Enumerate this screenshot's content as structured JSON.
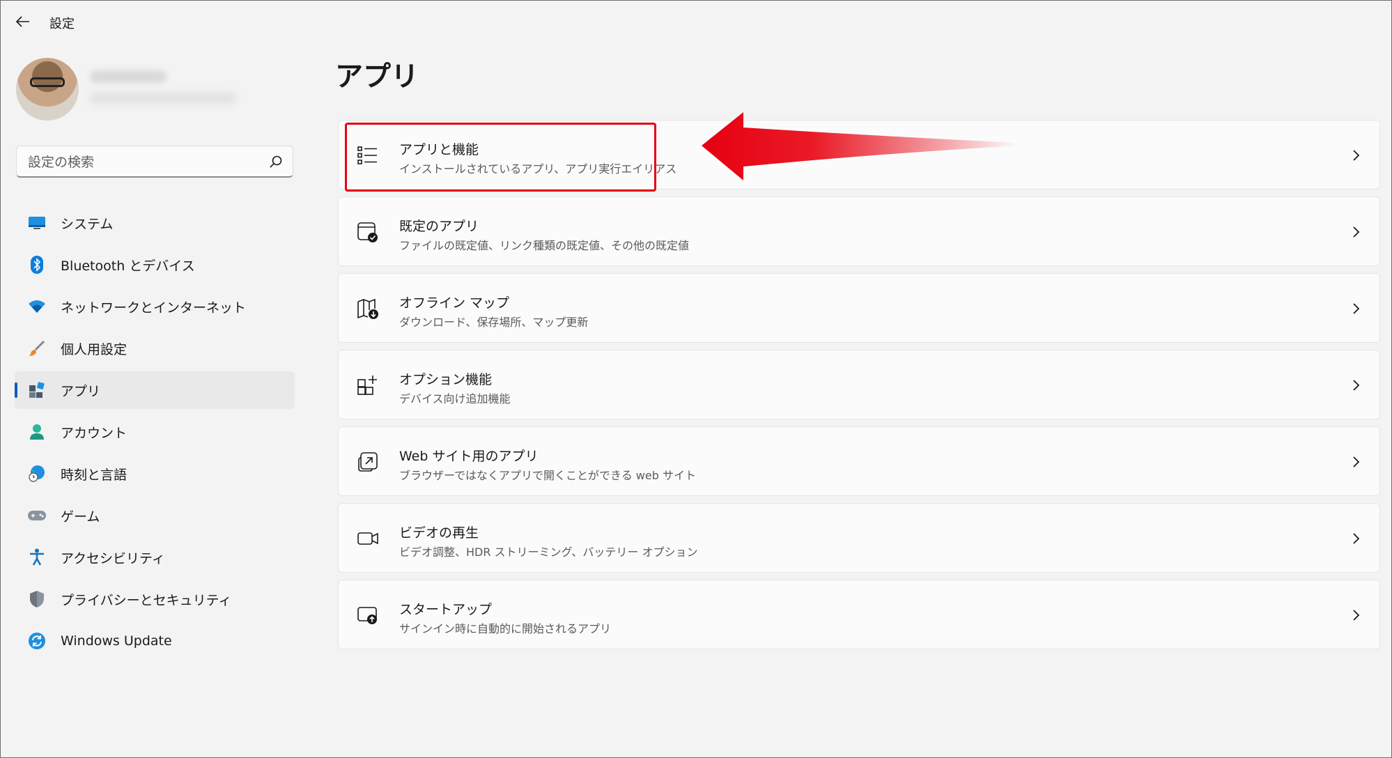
{
  "window": {
    "title": "設定"
  },
  "profile": {
    "name": "",
    "email": ""
  },
  "search": {
    "placeholder": "設定の検索"
  },
  "nav": [
    {
      "label": "システム",
      "icon": "monitor-icon"
    },
    {
      "label": "Bluetooth とデバイス",
      "icon": "bluetooth-icon"
    },
    {
      "label": "ネットワークとインターネット",
      "icon": "wifi-icon"
    },
    {
      "label": "個人用設定",
      "icon": "brush-icon"
    },
    {
      "label": "アプリ",
      "icon": "apps-icon",
      "active": true
    },
    {
      "label": "アカウント",
      "icon": "person-icon"
    },
    {
      "label": "時刻と言語",
      "icon": "globe-clock-icon"
    },
    {
      "label": "ゲーム",
      "icon": "gamepad-icon"
    },
    {
      "label": "アクセシビリティ",
      "icon": "accessibility-icon"
    },
    {
      "label": "プライバシーとセキュリティ",
      "icon": "shield-icon"
    },
    {
      "label": "Windows Update",
      "icon": "sync-icon"
    }
  ],
  "main": {
    "title": "アプリ",
    "cards": [
      {
        "title": "アプリと機能",
        "subtitle": "インストールされているアプリ、アプリ実行エイリアス",
        "icon": "list-icon"
      },
      {
        "title": "既定のアプリ",
        "subtitle": "ファイルの既定値、リンク種類の既定値、その他の既定値",
        "icon": "default-apps-icon"
      },
      {
        "title": "オフライン マップ",
        "subtitle": "ダウンロード、保存場所、マップ更新",
        "icon": "map-icon"
      },
      {
        "title": "オプション機能",
        "subtitle": "デバイス向け追加機能",
        "icon": "grid-plus-icon"
      },
      {
        "title": "Web サイト用のアプリ",
        "subtitle": "ブラウザーではなくアプリで開くことができる web サイト",
        "icon": "open-external-icon"
      },
      {
        "title": "ビデオの再生",
        "subtitle": "ビデオ調整、HDR ストリーミング、バッテリー オプション",
        "icon": "video-icon"
      },
      {
        "title": "スタートアップ",
        "subtitle": "サインイン時に自動的に開始されるアプリ",
        "icon": "startup-icon"
      }
    ]
  },
  "colors": {
    "accent": "#005fb8",
    "annotation": "#e60012"
  }
}
